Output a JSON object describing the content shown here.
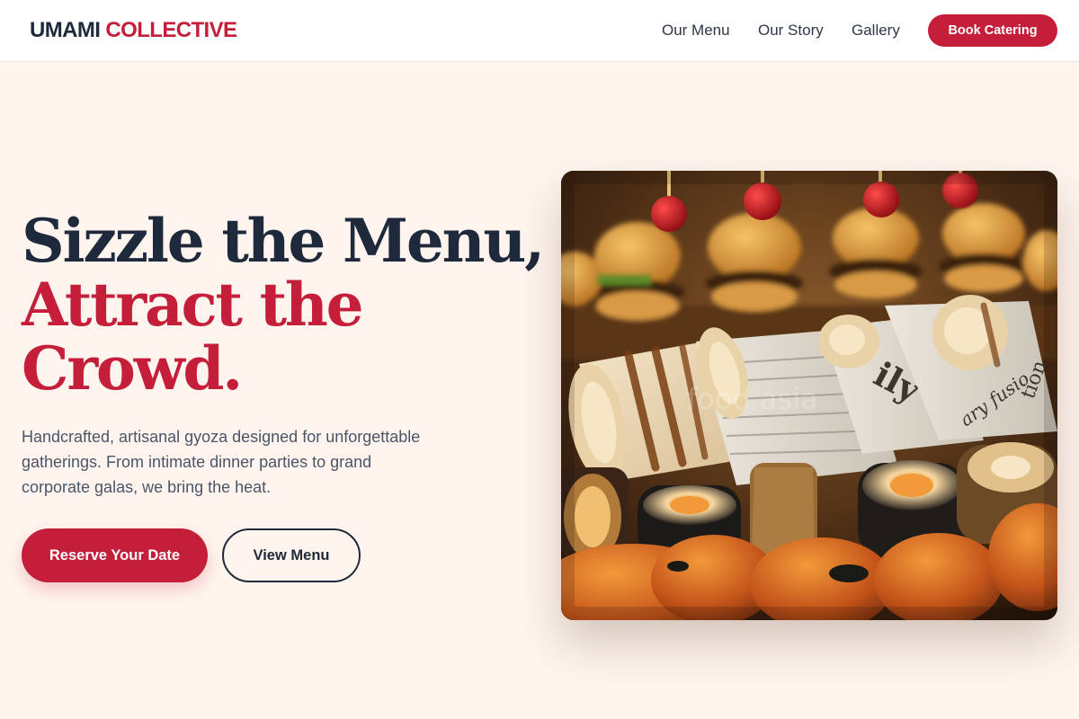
{
  "header": {
    "logo_part1": "UMAMI",
    "logo_part2": "COLLECTIVE",
    "nav": [
      "Our Menu",
      "Our Story",
      "Gallery"
    ],
    "cta": "Book Catering"
  },
  "hero": {
    "headline_line1": "Sizzle the Menu,",
    "headline_line2": "Attract the",
    "headline_line3": "Crowd.",
    "subtitle": "Handcrafted, artisanal gyoza designed for unforgettable gatherings. From intimate dinner parties to grand corporate galas, we bring the heat.",
    "primary_button": "Reserve Your Date",
    "secondary_button": "View Menu",
    "image_watermark": "food  asia"
  },
  "colors": {
    "accent": "#c41e3a",
    "ink": "#1e293b",
    "background": "#fff5ee"
  }
}
